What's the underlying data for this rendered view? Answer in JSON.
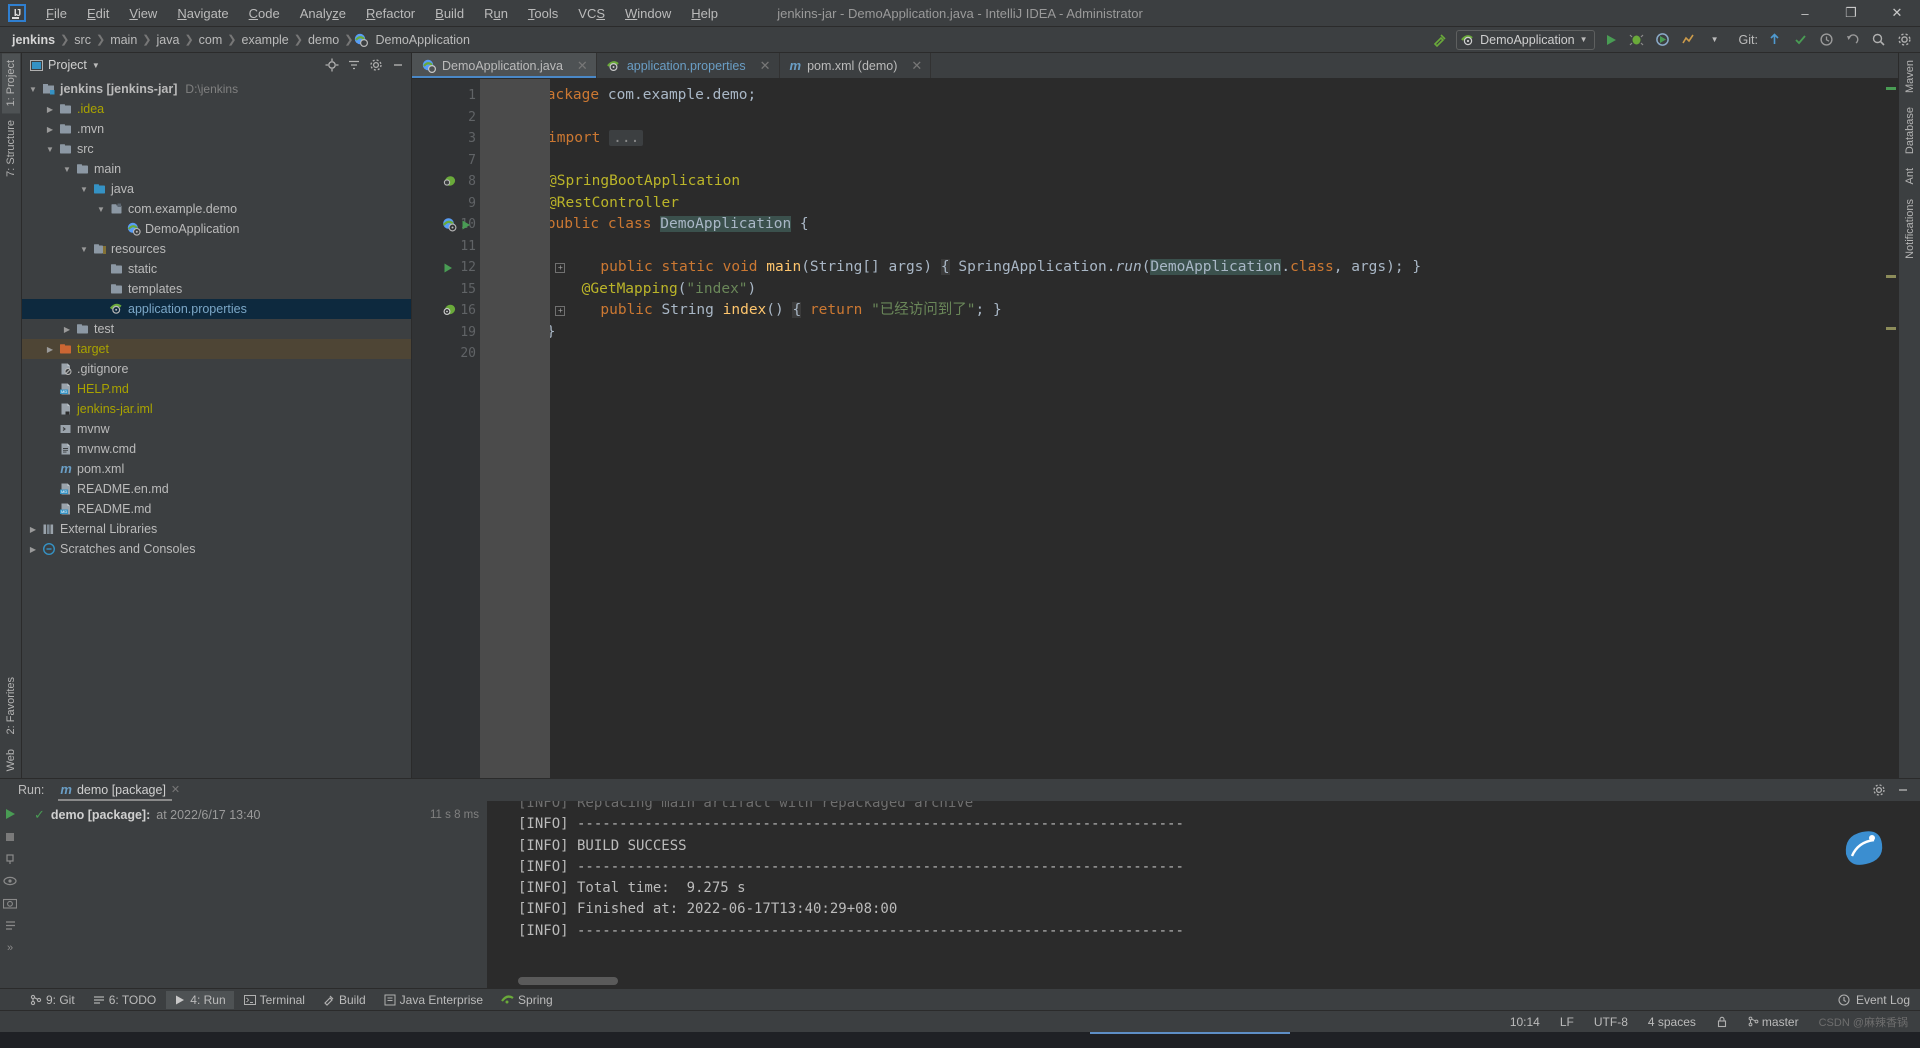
{
  "window": {
    "title": "jenkins-jar - DemoApplication.java - IntelliJ IDEA - Administrator",
    "logo_text": "IJ",
    "minimize": "–",
    "maximize": "❐",
    "close": "✕"
  },
  "menu": [
    {
      "label": "File",
      "mnemonic": "F"
    },
    {
      "label": "Edit",
      "mnemonic": "E"
    },
    {
      "label": "View",
      "mnemonic": "V"
    },
    {
      "label": "Navigate",
      "mnemonic": "N"
    },
    {
      "label": "Code",
      "mnemonic": "C"
    },
    {
      "label": "Analyze",
      "mnemonic": "z"
    },
    {
      "label": "Refactor",
      "mnemonic": "R"
    },
    {
      "label": "Build",
      "mnemonic": "B"
    },
    {
      "label": "Run",
      "mnemonic": "u"
    },
    {
      "label": "Tools",
      "mnemonic": "T"
    },
    {
      "label": "VCS",
      "mnemonic": "S"
    },
    {
      "label": "Window",
      "mnemonic": "W"
    },
    {
      "label": "Help",
      "mnemonic": "H"
    }
  ],
  "breadcrumbs": [
    {
      "label": "jenkins",
      "bold": true
    },
    {
      "label": "src"
    },
    {
      "label": "main"
    },
    {
      "label": "java"
    },
    {
      "label": "com"
    },
    {
      "label": "example"
    },
    {
      "label": "demo"
    },
    {
      "label": "DemoApplication",
      "icon": "spring-class-icon"
    }
  ],
  "toolbar": {
    "run_configuration": "DemoApplication",
    "git_label": "Git:",
    "icons": [
      "build-hammer-icon",
      "run-icon",
      "debug-icon",
      "run-with-coverage-icon",
      "profiler-icon",
      "update-project-icon",
      "commit-icon",
      "history-icon",
      "rollback-icon",
      "search-everywhere-icon",
      "settings-icon"
    ]
  },
  "left_tool_tabs": [
    {
      "label": "1: Project",
      "active": true
    },
    {
      "label": "7: Structure",
      "active": false
    },
    {
      "label": "2: Favorites",
      "active": false
    },
    {
      "label": "Web",
      "active": false
    }
  ],
  "right_tool_tabs": [
    {
      "label": "Maven"
    },
    {
      "label": "Database"
    },
    {
      "label": "Ant"
    },
    {
      "label": "Notifications"
    }
  ],
  "project_panel": {
    "title": "Project",
    "tools": [
      "locate-icon",
      "collapse-all-icon",
      "settings-gear-icon",
      "hide-icon"
    ],
    "tree": [
      {
        "indent": 0,
        "arrow": "down",
        "icon": "module-icon",
        "label": "jenkins [jenkins-jar]",
        "bold": true,
        "path": "D:\\jenkins",
        "color": "normal"
      },
      {
        "indent": 1,
        "arrow": "right",
        "icon": "folder-icon",
        "label": ".idea",
        "color": "yellowish"
      },
      {
        "indent": 1,
        "arrow": "right",
        "icon": "folder-icon",
        "label": ".mvn",
        "color": "normal"
      },
      {
        "indent": 1,
        "arrow": "down",
        "icon": "folder-icon",
        "label": "src",
        "color": "normal"
      },
      {
        "indent": 2,
        "arrow": "down",
        "icon": "folder-icon",
        "label": "main",
        "color": "normal"
      },
      {
        "indent": 3,
        "arrow": "down",
        "icon": "source-folder-icon",
        "label": "java",
        "color": "normal"
      },
      {
        "indent": 4,
        "arrow": "down",
        "icon": "package-icon",
        "label": "com.example.demo",
        "color": "normal"
      },
      {
        "indent": 5,
        "arrow": "none",
        "icon": "spring-class-icon",
        "label": "DemoApplication",
        "color": "normal"
      },
      {
        "indent": 3,
        "arrow": "down",
        "icon": "resource-folder-icon",
        "label": "resources",
        "color": "normal"
      },
      {
        "indent": 4,
        "arrow": "none",
        "icon": "folder-icon",
        "label": "static",
        "color": "normal"
      },
      {
        "indent": 4,
        "arrow": "none",
        "icon": "folder-icon",
        "label": "templates",
        "color": "normal"
      },
      {
        "indent": 4,
        "arrow": "none",
        "icon": "spring-prop-icon",
        "label": "application.properties",
        "color": "normal",
        "selected": true
      },
      {
        "indent": 2,
        "arrow": "right",
        "icon": "folder-icon",
        "label": "test",
        "color": "normal"
      },
      {
        "indent": 1,
        "arrow": "right",
        "icon": "excluded-folder-icon",
        "label": "target",
        "color": "yellowish",
        "excluded": true
      },
      {
        "indent": 1,
        "arrow": "none",
        "icon": "gitignore-file-icon",
        "label": ".gitignore",
        "color": "normal"
      },
      {
        "indent": 1,
        "arrow": "none",
        "icon": "markdown-file-icon",
        "label": "HELP.md",
        "color": "yellowish"
      },
      {
        "indent": 1,
        "arrow": "none",
        "icon": "iml-file-icon",
        "label": "jenkins-jar.iml",
        "color": "yellowish"
      },
      {
        "indent": 1,
        "arrow": "none",
        "icon": "script-file-icon",
        "label": "mvnw",
        "color": "normal"
      },
      {
        "indent": 1,
        "arrow": "none",
        "icon": "text-file-icon",
        "label": "mvnw.cmd",
        "color": "normal"
      },
      {
        "indent": 1,
        "arrow": "none",
        "icon": "maven-file-icon",
        "label": "pom.xml",
        "color": "normal"
      },
      {
        "indent": 1,
        "arrow": "none",
        "icon": "markdown-file-icon",
        "label": "README.en.md",
        "color": "normal"
      },
      {
        "indent": 1,
        "arrow": "none",
        "icon": "markdown-file-icon",
        "label": "README.md",
        "color": "normal"
      },
      {
        "indent": 0,
        "arrow": "right",
        "icon": "libraries-icon",
        "label": "External Libraries",
        "color": "normal"
      },
      {
        "indent": 0,
        "arrow": "right",
        "icon": "scratches-icon",
        "label": "Scratches and Consoles",
        "color": "normal"
      }
    ]
  },
  "editor": {
    "tabs": [
      {
        "label": "DemoApplication.java",
        "icon": "spring-class-icon",
        "active": true,
        "close": "✕"
      },
      {
        "label": "application.properties",
        "icon": "spring-prop-icon",
        "active": false,
        "close": "✕"
      },
      {
        "label": "pom.xml (demo)",
        "icon": "maven-file-icon",
        "active": false,
        "close": "✕"
      }
    ],
    "line_numbers": [
      "1",
      "2",
      "3",
      "7",
      "8",
      "9",
      "10",
      "11",
      "12",
      "15",
      "16",
      "19",
      "20"
    ],
    "lines": [
      "package com.example.demo;",
      "",
      "import ...",
      "",
      "@SpringBootApplication",
      "@RestController",
      "public class DemoApplication {",
      "",
      "    public static void main(String[] args) { SpringApplication.run(DemoApplication.class, args); }",
      "    @GetMapping(\"index\")",
      "    public String index() { return \"已经访问到了\"; }",
      "}",
      ""
    ],
    "gutter_markers": [
      {
        "line": "8",
        "icon": "spring-bean-icon"
      },
      {
        "line": "10",
        "icon": "spring-boot-icon"
      },
      {
        "line": "10",
        "icon": "run-gutter-icon"
      },
      {
        "line": "12",
        "icon": "run-gutter-icon"
      },
      {
        "line": "16",
        "icon": "spring-mapping-icon"
      }
    ]
  },
  "run_panel": {
    "label": "Run:",
    "tab": "demo [package]",
    "tab_close": "✕",
    "tree_item": "demo [package]:",
    "tree_timestamp": "at 2022/6/17 13:40",
    "duration": "11 s 8 ms",
    "console_lines": [
      "[INFO] Replacing main artifact with repackaged archive",
      "[INFO] ------------------------------------------------------------------------",
      "[INFO] BUILD SUCCESS",
      "[INFO] ------------------------------------------------------------------------",
      "[INFO] Total time:  9.275 s",
      "[INFO] Finished at: 2022-06-17T13:40:29+08:00",
      "[INFO] ------------------------------------------------------------------------"
    ]
  },
  "tool_windows": [
    {
      "label": "9: Git",
      "icon": "git-icon",
      "active": false
    },
    {
      "label": "6: TODO",
      "icon": "todo-icon",
      "active": false
    },
    {
      "label": "4: Run",
      "icon": "run-icon",
      "active": true
    },
    {
      "label": "Terminal",
      "icon": "terminal-icon",
      "active": false
    },
    {
      "label": "Build",
      "icon": "build-icon",
      "active": false
    },
    {
      "label": "Java Enterprise",
      "icon": "java-ee-icon",
      "active": false
    },
    {
      "label": "Spring",
      "icon": "spring-icon",
      "active": false
    }
  ],
  "event_log": "Event Log",
  "status_bar": {
    "position": "10:14",
    "line_separator": "LF",
    "encoding": "UTF-8",
    "indent": "4 spaces",
    "branch": "master",
    "lock_icon": "lock-icon",
    "watermark": "CSDN @麻辣香锅"
  },
  "colors": {
    "accent_blue": "#4a88c7",
    "selection_blue": "#0d293e",
    "excluded_brown": "#4e4535",
    "keyword_orange": "#cc7832",
    "annotation_yellow": "#bbb529",
    "string_green": "#6a8759",
    "method_yellow": "#ffc66d",
    "panel_bg": "#3c3f41",
    "editor_bg": "#2b2b2b",
    "green_run": "#499c54"
  }
}
